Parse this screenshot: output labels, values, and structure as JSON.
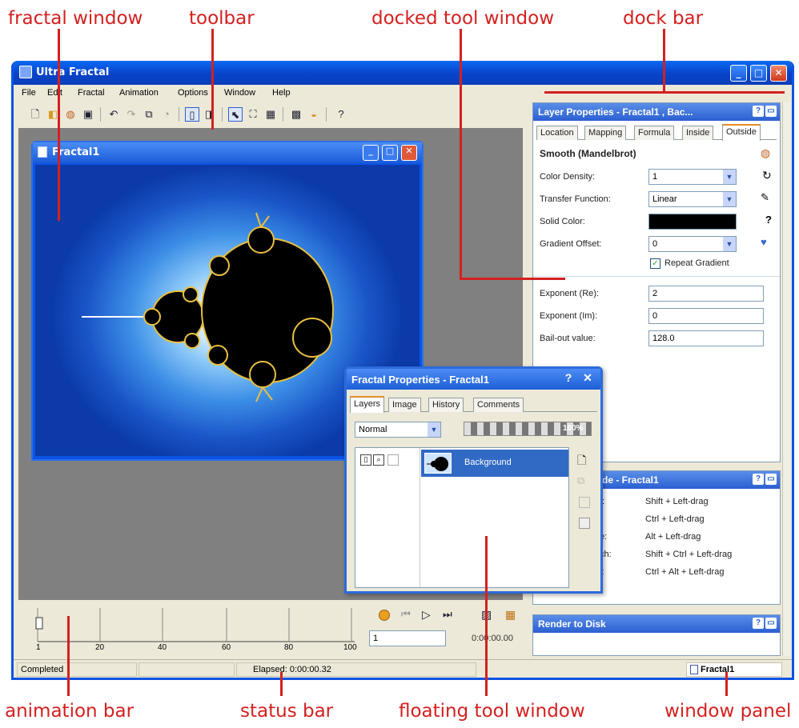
{
  "callouts": {
    "fractal_window": "fractal window",
    "toolbar": "toolbar",
    "docked_tool_window": "docked tool window",
    "dock_bar": "dock bar",
    "animation_bar": "animation bar",
    "status_bar": "status bar",
    "floating_tool_window": "floating tool window",
    "window_panel": "window panel"
  },
  "colors": {
    "callout": "#d42020",
    "title_blue": "#0a53e4",
    "chrome": "#ece9d8",
    "workspace": "#808080"
  },
  "app": {
    "title": "Ultra Fractal",
    "menu": [
      "File",
      "Edit",
      "Fractal",
      "Animation",
      "Options",
      "Window",
      "Help"
    ]
  },
  "toolbar_icons": [
    "new-icon",
    "open-icon",
    "parameters-icon",
    "save-icon",
    "undo-icon",
    "redo-icon",
    "copy-icon",
    "paste-icon",
    "layout1-icon",
    "layout2-icon",
    "select-icon",
    "zoom-icon",
    "tile-icon",
    "render-icon",
    "gradient-icon",
    "help-icon"
  ],
  "fractal_window": {
    "title": "Fractal1"
  },
  "layer_properties": {
    "title": "Layer Properties - Fractal1 , Bac...",
    "tabs": [
      "Location",
      "Mapping",
      "Formula",
      "Inside",
      "Outside"
    ],
    "active_tab": "Outside",
    "coloring": "Smooth (Mandelbrot)",
    "color_density_label": "Color Density:",
    "color_density": "1",
    "transfer_label": "Transfer Function:",
    "transfer": "Linear",
    "solid_label": "Solid Color:",
    "gradient_offset_label": "Gradient Offset:",
    "gradient_offset": "0",
    "repeat_gradient": "Repeat Gradient",
    "exp_re_label": "Exponent (Re):",
    "exp_re": "2",
    "exp_im_label": "Exponent (Im):",
    "exp_im": "0",
    "bailout_label": "Bail-out value:",
    "bailout": "128.0"
  },
  "guide_panel": {
    "title": "de - Fractal1",
    "rows": [
      {
        "k": "n:",
        "v": "Shift + Left-drag"
      },
      {
        "k": ":",
        "v": "Ctrl + Left-drag"
      },
      {
        "k": "te:",
        "v": "Alt + Left-drag"
      },
      {
        "k": "tch:",
        "v": "Shift + Ctrl + Left-drag"
      },
      {
        "k": "v:",
        "v": "Ctrl + Alt + Left-drag"
      }
    ]
  },
  "render_panel": {
    "title": "Render to Disk"
  },
  "fractal_properties": {
    "title": "Fractal Properties - Fractal1",
    "tabs": [
      "Layers",
      "Image",
      "History",
      "Comments"
    ],
    "active_tab": "Layers",
    "mode": "Normal",
    "opacity": "100%",
    "layer_name": "Background"
  },
  "animation": {
    "ticks": [
      "1",
      "20",
      "40",
      "60",
      "80",
      "100"
    ],
    "frame": "1",
    "time": "0:00:00.00"
  },
  "status": {
    "state": "Completed",
    "elapsed": "Elapsed: 0:00:00.32",
    "window": "Fractal1"
  }
}
